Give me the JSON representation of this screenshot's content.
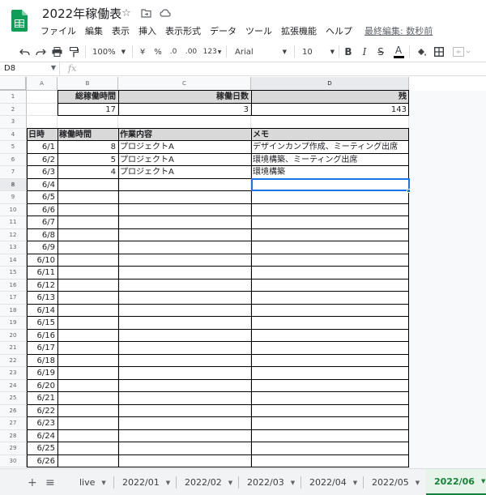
{
  "doc": {
    "title": "2022年稼働表",
    "menu": [
      "ファイル",
      "編集",
      "表示",
      "挿入",
      "表示形式",
      "データ",
      "ツール",
      "拡張機能",
      "ヘルプ"
    ],
    "last_edit": "最終編集: 数秒前"
  },
  "toolbar": {
    "zoom": "100%",
    "currency": "¥",
    "percent": "%",
    "dec_less": ".0",
    "dec_more": ".00",
    "format_more": "123",
    "font": "Arial",
    "size": "10",
    "bold": "B",
    "italic": "I",
    "strike": "S",
    "textcolor": "A"
  },
  "formula_bar": {
    "name_box": "D8",
    "fx": "fx"
  },
  "colors": {
    "header_fill": "#d9d9d9",
    "selection": "#1a73e8",
    "active_tab": "#188038"
  },
  "columns": [
    "A",
    "B",
    "C",
    "D"
  ],
  "rows": [
    "1",
    "2",
    "3",
    "4",
    "5",
    "6",
    "7",
    "8",
    "9",
    "10",
    "11",
    "12",
    "13",
    "14",
    "15",
    "16",
    "17",
    "18",
    "19",
    "20",
    "21",
    "22",
    "23",
    "24",
    "25",
    "26",
    "27",
    "28",
    "29",
    "30"
  ],
  "summary": {
    "total_hours_label": "総稼働時間",
    "days_label": "稼働日数",
    "remaining_label": "残",
    "total_hours": "17",
    "days": "3",
    "remaining": "143"
  },
  "table": {
    "headers": [
      "日時",
      "稼働時間",
      "作業内容",
      "メモ"
    ],
    "rows": [
      [
        "6/1",
        "8",
        "プロジェクトA",
        "デザインカンプ作成、ミーティング出席"
      ],
      [
        "6/2",
        "5",
        "プロジェクトA",
        "環境構築、ミーティング出席"
      ],
      [
        "6/3",
        "4",
        "プロジェクトA",
        "環境構築"
      ],
      [
        "6/4",
        "",
        "",
        ""
      ],
      [
        "6/5",
        "",
        "",
        ""
      ],
      [
        "6/6",
        "",
        "",
        ""
      ],
      [
        "6/7",
        "",
        "",
        ""
      ],
      [
        "6/8",
        "",
        "",
        ""
      ],
      [
        "6/9",
        "",
        "",
        ""
      ],
      [
        "6/10",
        "",
        "",
        ""
      ],
      [
        "6/11",
        "",
        "",
        ""
      ],
      [
        "6/12",
        "",
        "",
        ""
      ],
      [
        "6/13",
        "",
        "",
        ""
      ],
      [
        "6/14",
        "",
        "",
        ""
      ],
      [
        "6/15",
        "",
        "",
        ""
      ],
      [
        "6/16",
        "",
        "",
        ""
      ],
      [
        "6/17",
        "",
        "",
        ""
      ],
      [
        "6/18",
        "",
        "",
        ""
      ],
      [
        "6/19",
        "",
        "",
        ""
      ],
      [
        "6/20",
        "",
        "",
        ""
      ],
      [
        "6/21",
        "",
        "",
        ""
      ],
      [
        "6/22",
        "",
        "",
        ""
      ],
      [
        "6/23",
        "",
        "",
        ""
      ],
      [
        "6/24",
        "",
        "",
        ""
      ],
      [
        "6/25",
        "",
        "",
        ""
      ],
      [
        "6/26",
        "",
        "",
        ""
      ]
    ]
  },
  "selected_cell": "D8",
  "sheet_tabs": {
    "add": "+",
    "list": "≡",
    "tabs": [
      "live",
      "2022/01",
      "2022/02",
      "2022/03",
      "2022/04",
      "2022/05",
      "2022/06"
    ],
    "active": "2022/06"
  }
}
